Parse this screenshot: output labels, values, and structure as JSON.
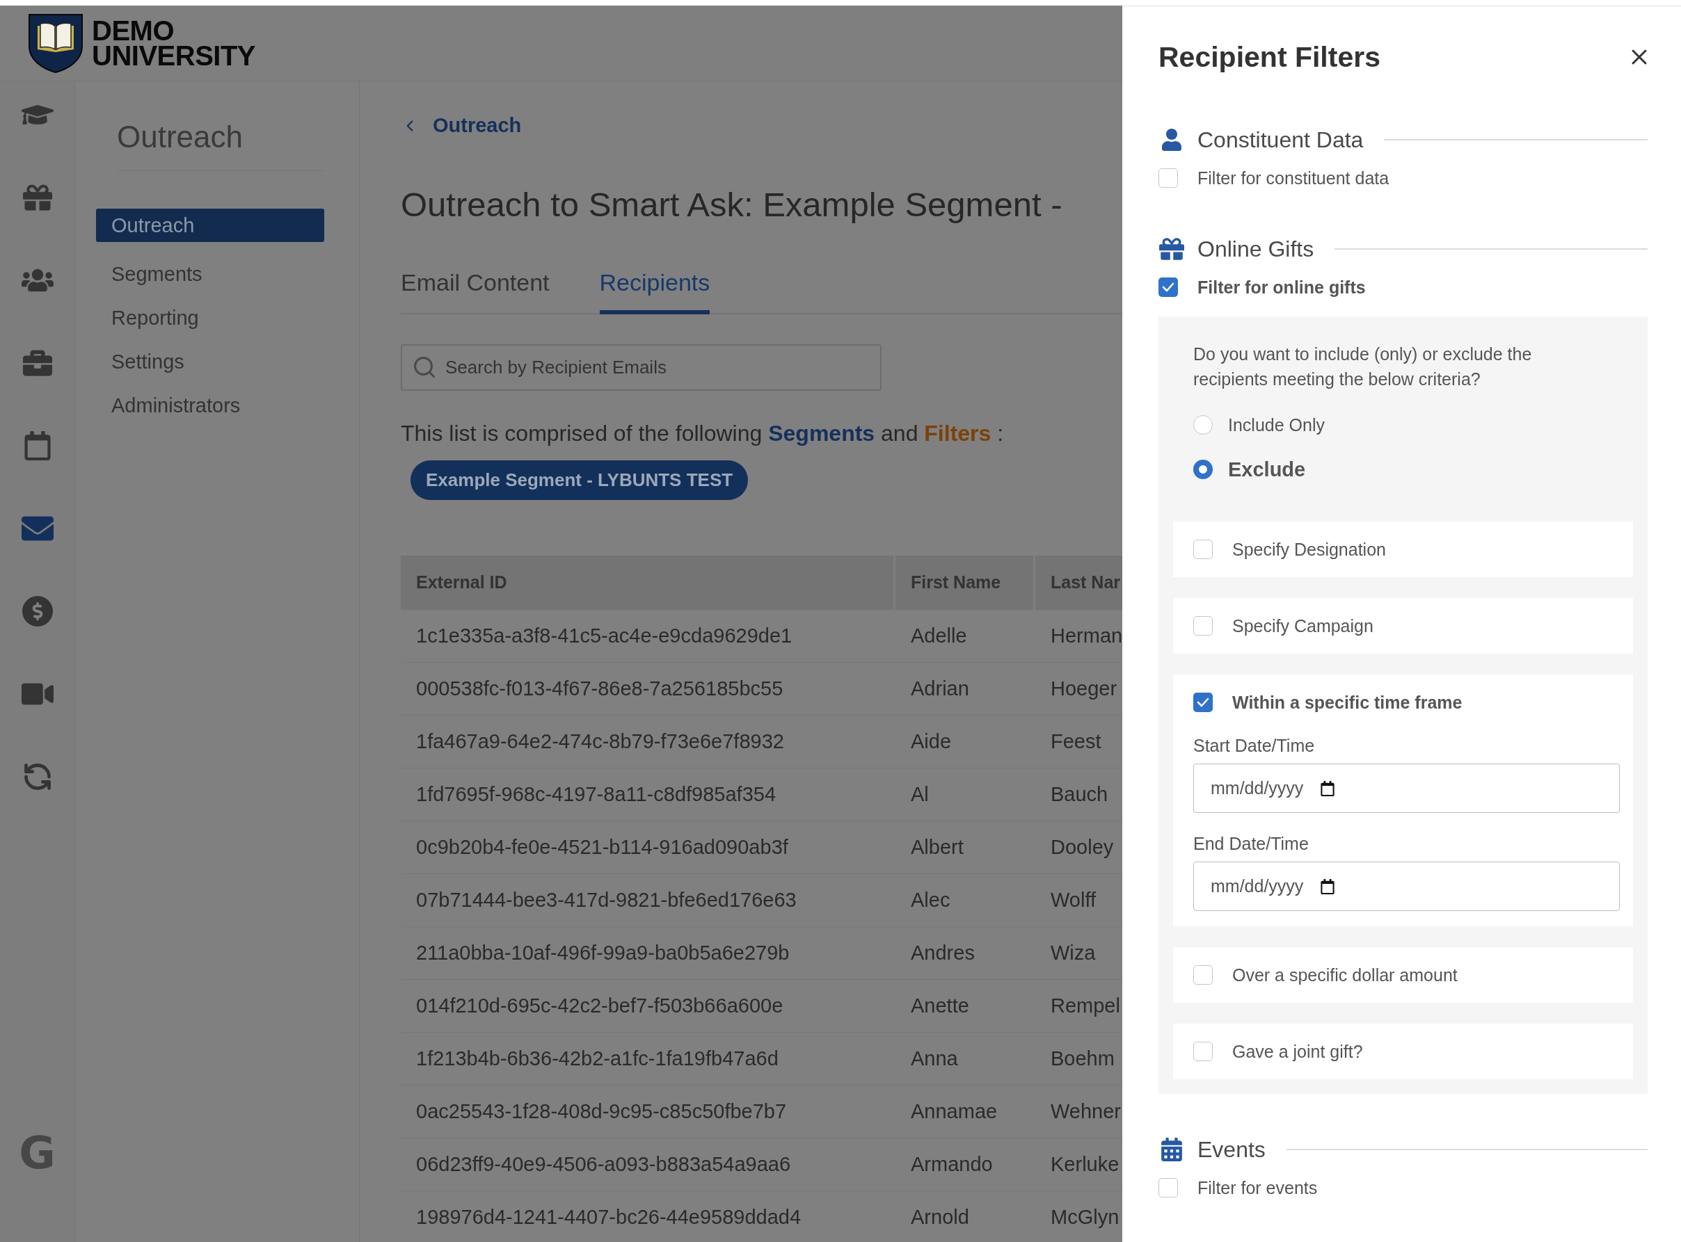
{
  "header": {
    "logo_lines": [
      "DEMO",
      "UNIVERSITY"
    ]
  },
  "rail": {
    "items": [
      {
        "kind": "graduation",
        "selected": false
      },
      {
        "kind": "gift",
        "selected": false
      },
      {
        "kind": "people",
        "selected": false
      },
      {
        "kind": "briefcase",
        "selected": false
      },
      {
        "kind": "calendar",
        "selected": false
      },
      {
        "kind": "mail",
        "selected": true
      },
      {
        "kind": "dollar",
        "selected": false
      },
      {
        "kind": "video",
        "selected": false
      },
      {
        "kind": "sync",
        "selected": false
      }
    ],
    "footer_logo": "G"
  },
  "sidebar": {
    "title": "Outreach",
    "items": [
      {
        "label": "Outreach",
        "selected": true
      },
      {
        "label": "Segments",
        "selected": false
      },
      {
        "label": "Reporting",
        "selected": false
      },
      {
        "label": "Settings",
        "selected": false
      },
      {
        "label": "Administrators",
        "selected": false
      }
    ]
  },
  "breadcrumb": "Outreach",
  "title": "Outreach to Smart Ask: Example Segment -",
  "tabs": [
    {
      "label": "Email Content",
      "selected": false
    },
    {
      "label": "Recipients",
      "selected": true
    }
  ],
  "search": {
    "placeholder": "Search by Recipient Emails"
  },
  "composition": {
    "prefix": "This list is comprised of the following",
    "segments": "Segments",
    "joiner": "and",
    "filters": "Filters",
    "suffix": ":"
  },
  "chips": [
    "Example Segment - LYBUNTS TEST"
  ],
  "table": {
    "columns": [
      "External ID",
      "First Name",
      "Last Nar"
    ],
    "rows": [
      [
        "1c1e335a-a3f8-41c5-ac4e-e9cda9629de1",
        "Adelle",
        "Herman"
      ],
      [
        "000538fc-f013-4f67-86e8-7a256185bc55",
        "Adrian",
        "Hoeger"
      ],
      [
        "1fa467a9-64e2-474c-8b79-f73e6e7f8932",
        "Aide",
        "Feest"
      ],
      [
        "1fd7695f-968c-4197-8a11-c8df985af354",
        "Al",
        "Bauch"
      ],
      [
        "0c9b20b4-fe0e-4521-b114-916ad090ab3f",
        "Albert",
        "Dooley"
      ],
      [
        "07b71444-bee3-417d-9821-bfe6ed176e63",
        "Alec",
        "Wolff"
      ],
      [
        "211a0bba-10af-496f-99a9-ba0b5a6e279b",
        "Andres",
        "Wiza"
      ],
      [
        "014f210d-695c-42c2-bef7-f503b66a600e",
        "Anette",
        "Rempel"
      ],
      [
        "1f213b4b-6b36-42b2-a1fc-1fa19fb47a6d",
        "Anna",
        "Boehm"
      ],
      [
        "0ac25543-1f28-408d-9c95-c85c50fbe7b7",
        "Annamae",
        "Wehner"
      ],
      [
        "06d23ff9-40e9-4506-a093-b883a54a9aa6",
        "Armando",
        "Kerluke"
      ],
      [
        "198976d4-1241-4407-bc26-44e9589ddad4",
        "Arnold",
        "McGlyn"
      ]
    ]
  },
  "drawer": {
    "title": "Recipient Filters",
    "sections": [
      {
        "kind": "person",
        "heading": "Constituent Data",
        "filter": {
          "label": "Filter for constituent data",
          "checked": false
        }
      },
      {
        "kind": "gift",
        "heading": "Online Gifts",
        "filter": {
          "label": "Filter for online gifts",
          "checked": true
        },
        "panel": {
          "question": "Do you want to include (only) or exclude the recipients meeting the below criteria?",
          "options": [
            {
              "label": "Include Only",
              "selected": false
            },
            {
              "label": "Exclude",
              "selected": true
            }
          ],
          "criteria": [
            {
              "label": "Specify Designation",
              "checked": false
            },
            {
              "label": "Specify Campaign",
              "checked": false
            },
            {
              "label": "Within a specific time frame",
              "checked": true,
              "fields": [
                {
                  "label": "Start Date/Time",
                  "placeholder": "mm/dd/yyyy"
                },
                {
                  "label": "End Date/Time",
                  "placeholder": "mm/dd/yyyy"
                }
              ]
            },
            {
              "label": "Over a specific dollar amount",
              "checked": false
            },
            {
              "label": "Gave a joint gift?",
              "checked": false
            }
          ]
        }
      },
      {
        "kind": "calendar",
        "heading": "Events",
        "filter": {
          "label": "Filter for events",
          "checked": false
        }
      }
    ]
  }
}
